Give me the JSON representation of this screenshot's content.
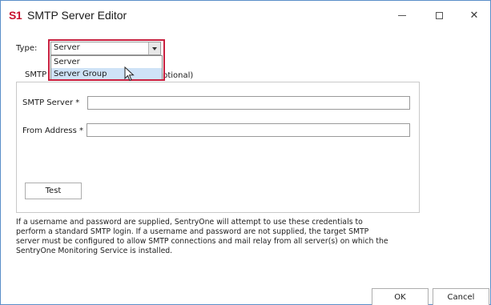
{
  "window": {
    "logo_text": "S1",
    "title": "SMTP Server Editor",
    "controls": {
      "minimize_icon": "minimize-icon",
      "maximize_icon": "maximize-icon",
      "close_icon": "close-icon",
      "close_glyph": "✕"
    }
  },
  "type_field": {
    "label": "Type:",
    "selected": "Server",
    "options": [
      "Server",
      "Server Group"
    ],
    "hovered_option": "Server Group"
  },
  "tabs": {
    "active_visible": "SMTP",
    "second_visible_tail": "ptional)"
  },
  "form": {
    "smtp_server_label": "SMTP Server *",
    "smtp_server_value": "",
    "from_address_label": "From Address *",
    "from_address_value": "",
    "test_label": "Test"
  },
  "note": "If a username and password are supplied, SentryOne will attempt to use these credentials to perform a standard SMTP login.  If a username and password are not supplied, the target SMTP server must be configured to allow SMTP connections and mail relay from all server(s) on which the SentryOne Monitoring Service is installed.",
  "footer": {
    "ok_label": "OK",
    "cancel_label": "Cancel"
  },
  "colors": {
    "brand_red": "#c8102e",
    "highlight_border": "#c8203f",
    "selected_option_bg": "#cfe3f7"
  }
}
